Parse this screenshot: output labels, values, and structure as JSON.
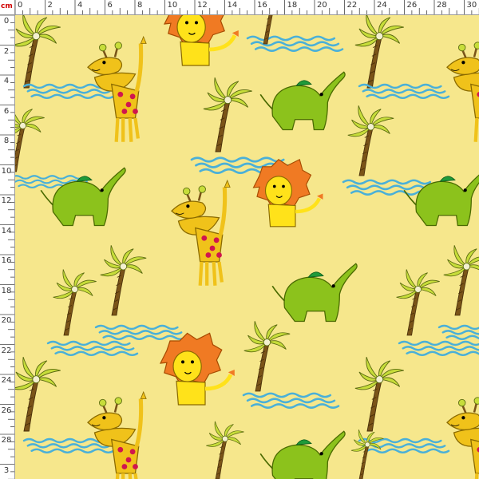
{
  "ruler": {
    "unit": "cm",
    "x_labels": [
      "0",
      "2",
      "4",
      "6",
      "8",
      "10",
      "12",
      "14",
      "16",
      "18",
      "20",
      "22",
      "24",
      "26",
      "28",
      "30"
    ],
    "y_labels": [
      "0",
      "2",
      "4",
      "6",
      "8",
      "10",
      "12",
      "14",
      "16",
      "18",
      "20",
      "22",
      "24",
      "26",
      "28",
      "3"
    ]
  },
  "pattern": {
    "background_color": "#f6e78c",
    "motifs": [
      "palm-tree",
      "giraffe",
      "lion",
      "elephant",
      "water-waves"
    ],
    "colors": {
      "palm_leaf": "#c7dd3a",
      "palm_trunk": "#7a5418",
      "wave": "#4ab0d8",
      "giraffe_body": "#f0c21a",
      "giraffe_spot": "#d0154e",
      "lion_mane": "#f07a23",
      "lion_body": "#ffe21a",
      "elephant": "#8cc21c",
      "elephant_hat": "#1f9a3a"
    }
  }
}
